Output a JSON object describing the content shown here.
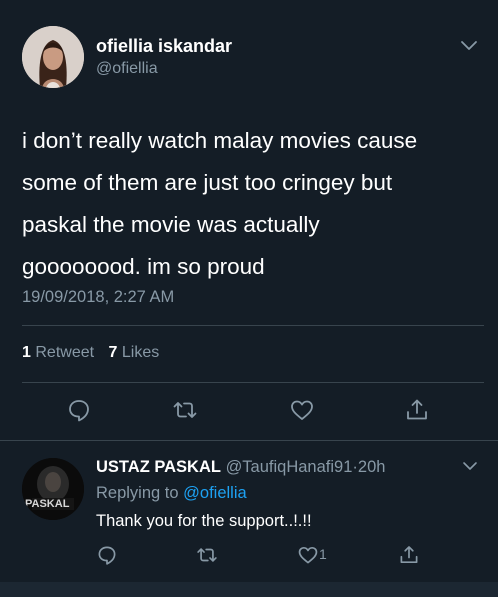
{
  "tweet": {
    "author_name": "ofiellia iskandar",
    "author_handle": "@ofiellia",
    "text_lines": [
      "i don’t really watch malay movies cause",
      "some of them are just too cringey but",
      "paskal the movie was actually",
      "goooooood. im so proud"
    ],
    "timestamp": "19/09/2018, 2:27 AM",
    "retweet_count": "1",
    "retweet_label": "Retweet",
    "like_count": "7",
    "like_label": "Likes"
  },
  "reply": {
    "author_name": "USTAZ PASKAL",
    "author_handle": "@TaufiqHanafi91",
    "separator": "·",
    "time_ago": "20h",
    "replying_to_label": "Replying to",
    "replying_to_handle": "@ofiellia",
    "text": "Thank you for the support..!.!!",
    "like_count": "1",
    "avatar_text": "PASKAL"
  },
  "icons": {
    "reply": "reply-icon",
    "retweet": "retweet-icon",
    "like": "heart-icon",
    "share": "share-icon",
    "more": "chevron-down-icon"
  },
  "colors": {
    "background": "#141d26",
    "secondary_text": "#8899a6",
    "link": "#1da1f2",
    "divider": "#38444d"
  }
}
